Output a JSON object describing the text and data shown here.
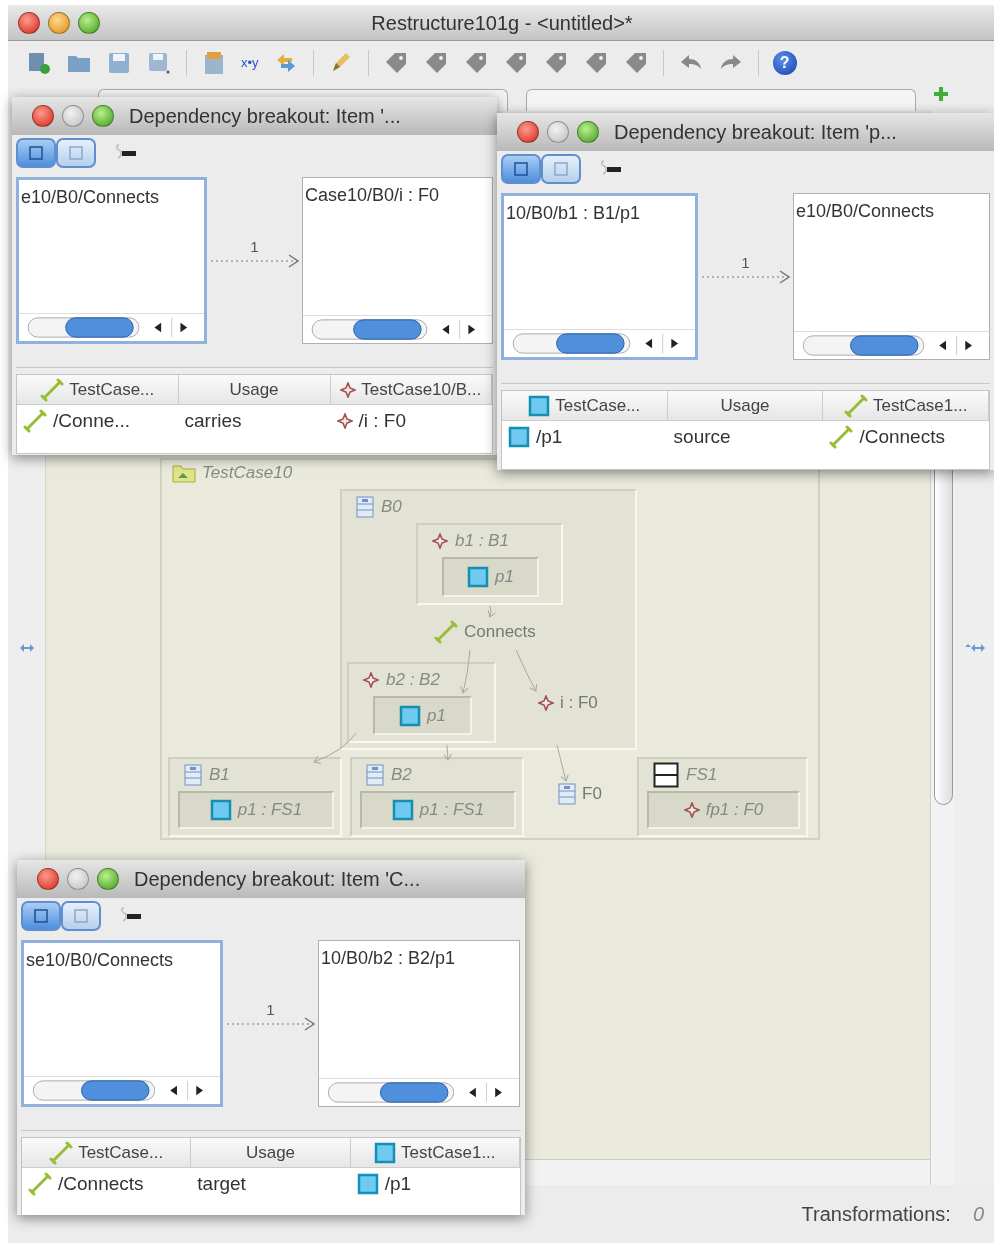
{
  "window": {
    "title": "Restructure101g - <untitled>*"
  },
  "toolbar": {
    "text_button": "x•y",
    "help_glyph": "?"
  },
  "diagram": {
    "package": "TestCase10",
    "nodes": [
      {
        "kind": "class",
        "label": "B0",
        "children": [
          {
            "kind": "part",
            "label": "b1 : B1",
            "children": [
              {
                "kind": "port",
                "label": "p1"
              }
            ]
          },
          {
            "kind": "connector",
            "label": "Connects"
          },
          {
            "kind": "part",
            "label": "b2 : B2",
            "children": [
              {
                "kind": "port",
                "label": "p1"
              }
            ]
          },
          {
            "kind": "flow",
            "label": "i : F0"
          }
        ]
      },
      {
        "kind": "class",
        "label": "B1",
        "children": [
          {
            "kind": "port",
            "label": "p1 : FS1"
          }
        ]
      },
      {
        "kind": "class",
        "label": "B2",
        "children": [
          {
            "kind": "port",
            "label": "p1 : FS1"
          }
        ]
      },
      {
        "kind": "class",
        "label": "F0"
      },
      {
        "kind": "flowspec",
        "label": "FS1",
        "children": [
          {
            "kind": "flow",
            "label": "fp1 : F0"
          }
        ]
      }
    ]
  },
  "dialogs": [
    {
      "title": "Dependency breakout: Item '...",
      "view_buttons": [
        {
          "selected": true
        },
        {
          "selected": false
        }
      ],
      "panels": [
        {
          "label": "e10/B0/Connects",
          "focused": true
        },
        {
          "label": "Case10/B0/i : F0",
          "focused": false
        }
      ],
      "count": "1",
      "columns": [
        {
          "label": "TestCase...",
          "kind": "connector"
        },
        {
          "label": "Usage",
          "kind": "none"
        },
        {
          "label": "TestCase10/B...",
          "kind": "part"
        }
      ],
      "rows": [
        [
          {
            "text": "/Conne...",
            "kind": "connector"
          },
          {
            "text": "carries",
            "kind": "none"
          },
          {
            "text": "/i : F0",
            "kind": "part"
          }
        ]
      ]
    },
    {
      "title": "Dependency breakout: Item 'p...",
      "view_buttons": [
        {
          "selected": true
        },
        {
          "selected": false
        }
      ],
      "panels": [
        {
          "label": "10/B0/b1 : B1/p1",
          "focused": true
        },
        {
          "label": "e10/B0/Connects",
          "focused": false
        }
      ],
      "count": "1",
      "columns": [
        {
          "label": "TestCase...",
          "kind": "port"
        },
        {
          "label": "Usage",
          "kind": "none"
        },
        {
          "label": "TestCase1...",
          "kind": "connector"
        }
      ],
      "rows": [
        [
          {
            "text": "/p1",
            "kind": "port"
          },
          {
            "text": "source",
            "kind": "none"
          },
          {
            "text": "/Connects",
            "kind": "connector"
          }
        ]
      ]
    },
    {
      "title": "Dependency breakout: Item 'C...",
      "view_buttons": [
        {
          "selected": true
        },
        {
          "selected": false
        }
      ],
      "panels": [
        {
          "label": "se10/B0/Connects",
          "focused": true
        },
        {
          "label": "10/B0/b2 : B2/p1",
          "focused": false
        }
      ],
      "count": "1",
      "columns": [
        {
          "label": "TestCase...",
          "kind": "connector"
        },
        {
          "label": "Usage",
          "kind": "none"
        },
        {
          "label": "TestCase1...",
          "kind": "port"
        }
      ],
      "rows": [
        [
          {
            "text": "/Connects",
            "kind": "connector"
          },
          {
            "text": "target",
            "kind": "none"
          },
          {
            "text": "/p1",
            "kind": "port"
          }
        ]
      ]
    }
  ],
  "status": {
    "label": "Transformations:",
    "value": "0"
  }
}
